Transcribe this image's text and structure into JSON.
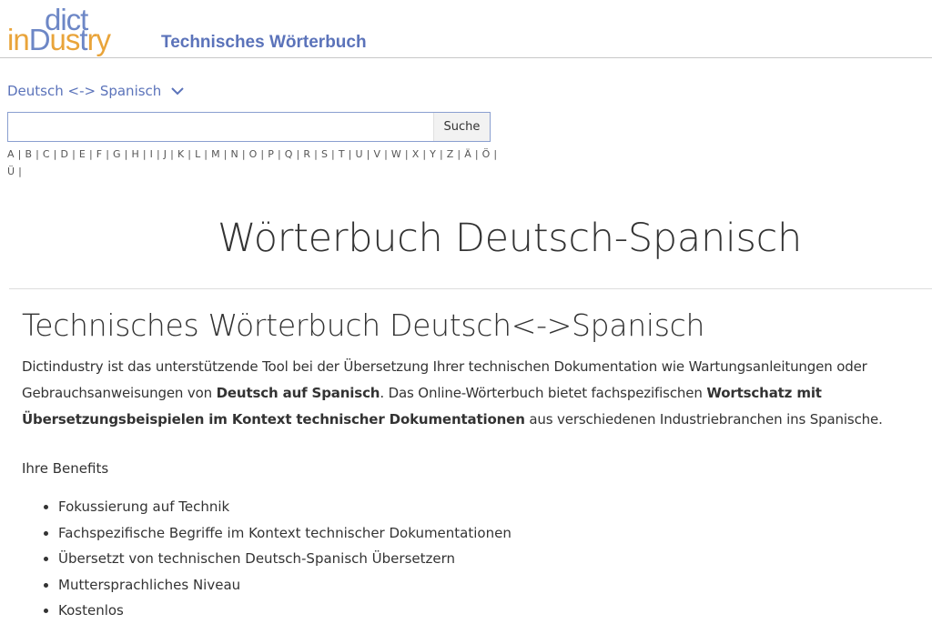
{
  "brand": {
    "logo_top": "dict",
    "logo_in": "in",
    "logo_d": "D",
    "logo_us": "us",
    "logo_t": "t",
    "logo_ry": "ry",
    "title": "Technisches Wörterbuch"
  },
  "language_selector": {
    "label": "Deutsch <-> Spanisch",
    "icon": "chevron-down-icon"
  },
  "search": {
    "value": "",
    "placeholder": "",
    "button_label": "Suche"
  },
  "alphabet": [
    "A",
    "B",
    "C",
    "D",
    "E",
    "F",
    "G",
    "H",
    "I",
    "J",
    "K",
    "L",
    "M",
    "N",
    "O",
    "P",
    "Q",
    "R",
    "S",
    "T",
    "U",
    "V",
    "W",
    "X",
    "Y",
    "Z",
    "Ä",
    "Ö",
    "Ü"
  ],
  "page_title": "Wörterbuch Deutsch-Spanisch",
  "section": {
    "title": "Technisches Wörterbuch Deutsch<->Spanisch",
    "intro_1": "Dictindustry ist das unterstützende Tool bei der Übersetzung Ihrer technischen Dokumentation wie Wartungsanleitungen oder Gebrauchsanweisungen von ",
    "intro_bold_1": "Deutsch auf Spanisch",
    "intro_2": ". Das Online-Wörterbuch bietet fachspezifischen ",
    "intro_bold_2": "Wortschatz mit Übersetzungsbeispielen im Kontext technischer Dokumentationen",
    "intro_3": " aus verschiedenen Industriebranchen ins Spanische.",
    "benefits_label": "Ihre Benefits",
    "benefits": [
      "Fokussierung auf Technik",
      "Fachspezifische Begriffe im Kontext technischer Dokumentationen",
      "Übersetzt von technischen Deutsch-Spanisch Übersetzern",
      "Muttersprachliches Niveau",
      "Kostenlos"
    ]
  },
  "colors": {
    "brand_blue": "#5b73ba",
    "brand_orange": "#e9a43a",
    "text": "#333333"
  }
}
